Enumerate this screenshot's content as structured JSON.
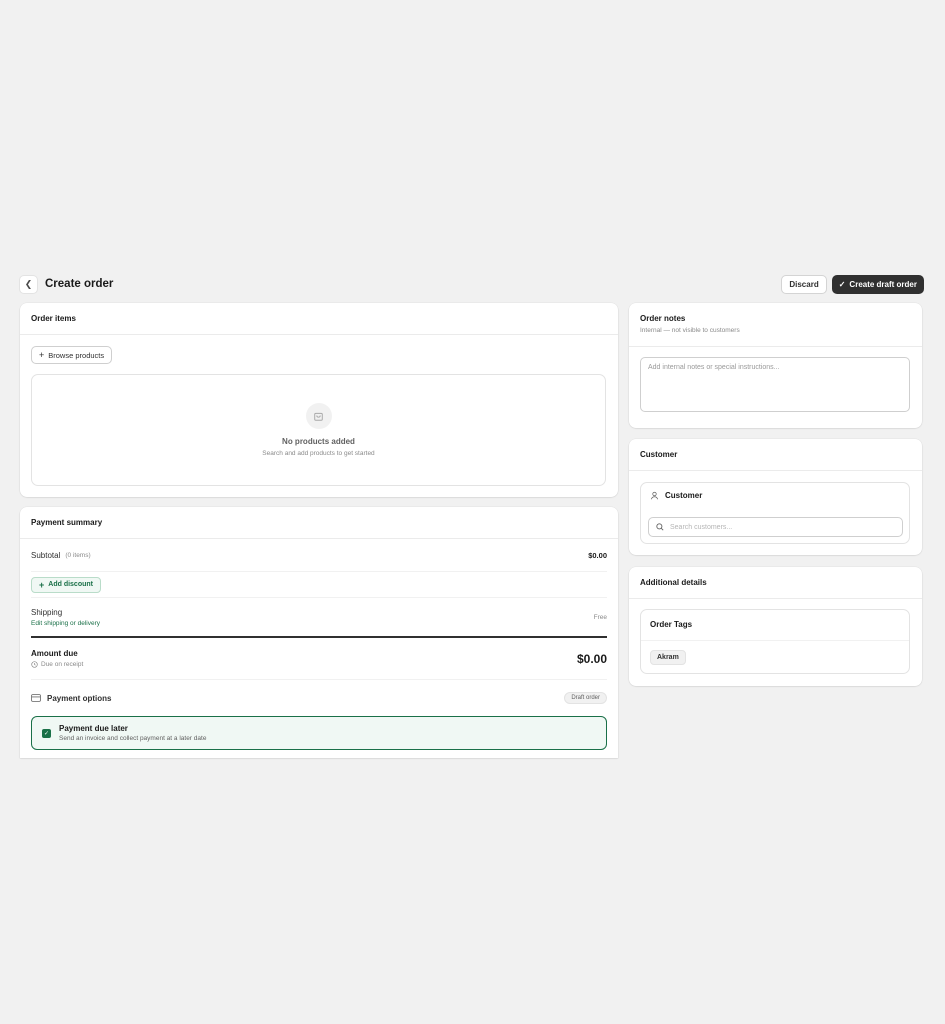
{
  "header": {
    "title": "Create order",
    "discard_label": "Discard",
    "primary_label": "Create draft order"
  },
  "order_items": {
    "title": "Order items",
    "browse_label": "Browse products",
    "empty_title": "No products added",
    "empty_sub": "Search and add products to get started"
  },
  "payment_summary": {
    "title": "Payment summary",
    "subtotal_label": "Subtotal",
    "subtotal_items": "(0 items)",
    "subtotal_amount": "$0.00",
    "discount_label": "Add discount",
    "shipping_label": "Shipping",
    "shipping_link": "Edit shipping or delivery",
    "shipping_value": "Free",
    "amount_due_label": "Amount due",
    "amount_due_sub": "Due on receipt",
    "amount_due_value": "$0.00",
    "payment_options_label": "Payment options",
    "payment_options_badge": "Draft order",
    "pay_later_title": "Payment due later",
    "pay_later_sub": "Send an invoice and collect payment at a later date"
  },
  "order_notes": {
    "title": "Order notes",
    "subtitle": "Internal — not visible to customers",
    "placeholder": "Add internal notes or special instructions..."
  },
  "customer": {
    "title": "Customer",
    "box_title": "Customer",
    "search_placeholder": "Search customers..."
  },
  "additional_details": {
    "title": "Additional details",
    "tags_title": "Order Tags",
    "tags": [
      "Akram"
    ]
  },
  "colors": {
    "accent_green": "#1a7048",
    "primary_dark": "#303030",
    "background": "#f1f1f1"
  }
}
